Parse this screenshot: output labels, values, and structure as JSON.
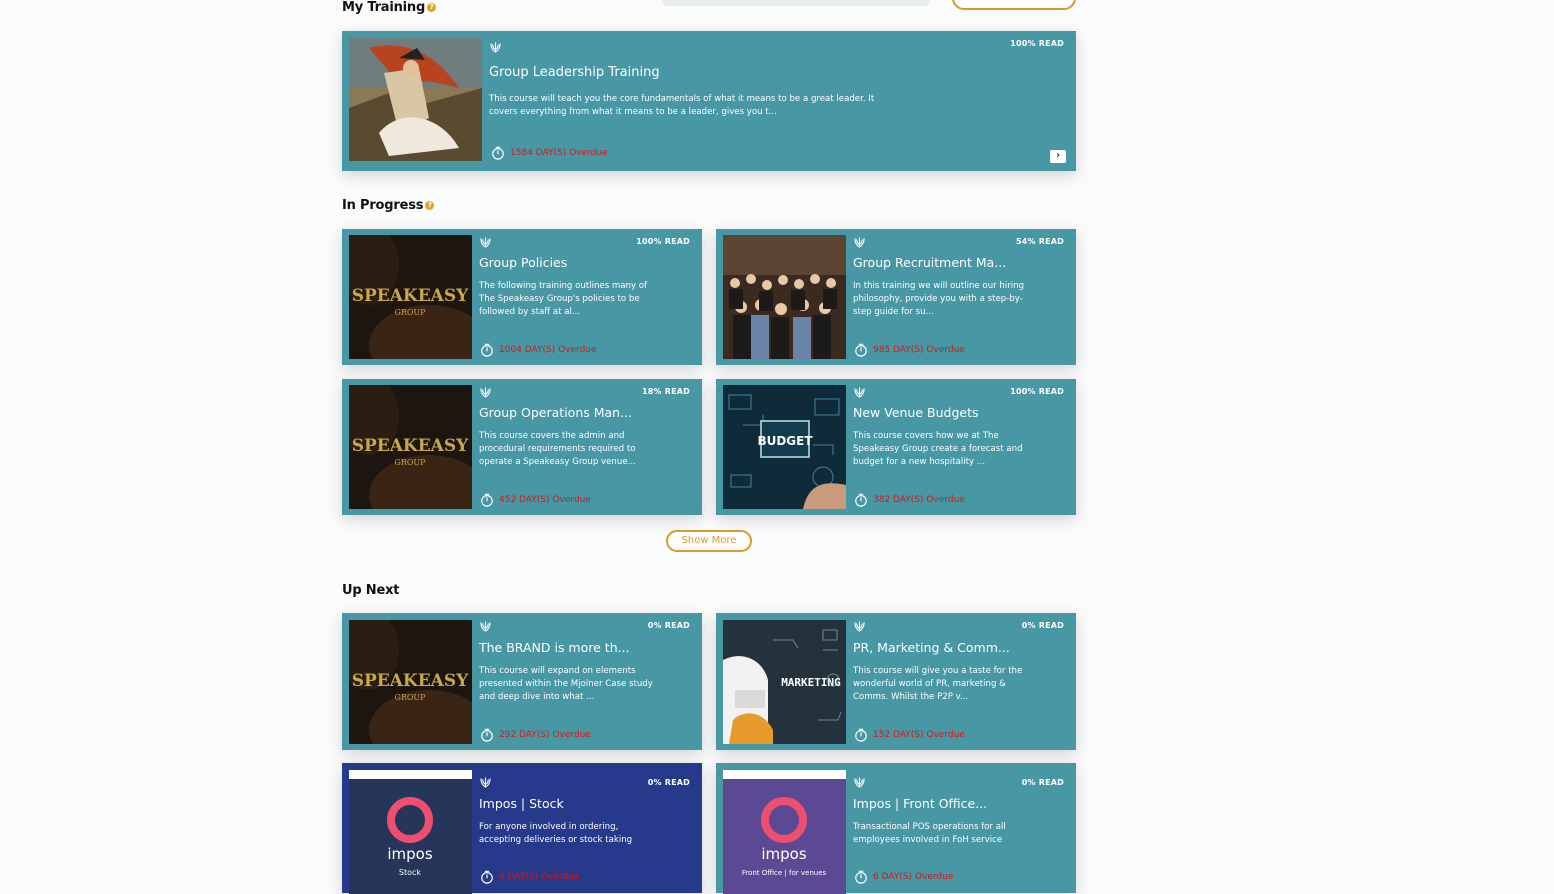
{
  "sections": {
    "my_training": "My Training",
    "in_progress": "In Progress",
    "up_next": "Up Next",
    "help_glyph": "?"
  },
  "featured": {
    "title": "Group Leadership Training",
    "progress": "100% READ",
    "description": "This course will teach you the core fundamentals of what it means to be a great leader. It covers everything from what it means to be a leader, gives you t...",
    "overdue": "1584 DAY(S) Overdue",
    "open_glyph": "›"
  },
  "in_progress": [
    {
      "title": "Group Policies",
      "progress": "100% READ",
      "description": "The following training outlines many of The Speakeasy Group's policies to be followed by staff at al...",
      "overdue": "1004 DAY(S) Overdue",
      "image": "speakeasy-logo"
    },
    {
      "title": "Group Recruitment Ma...",
      "progress": "54% READ",
      "description": "In this training we will outline our hiring philosophy, provide you with a step-by-step guide for su...",
      "overdue": "985 DAY(S) Overdue",
      "image": "team-photo"
    },
    {
      "title": "Group Operations Man...",
      "progress": "18% READ",
      "description": "This course covers the admin and procedural requirements required to operate a Speakeasy Group venue...",
      "overdue": "452 DAY(S) Overdue",
      "image": "speakeasy-logo"
    },
    {
      "title": "New Venue Budgets",
      "progress": "100% READ",
      "description": "This course covers how we at The Speakeasy Group create a forecast and budget for a new hospitality ...",
      "overdue": "382 DAY(S) Overdue",
      "image": "budget-graphic"
    }
  ],
  "show_more_label": "Show More",
  "up_next": [
    {
      "title": "The BRAND is more th...",
      "progress": "0% READ",
      "description": "This course will expand on elements presented within the Mjolner Case study and deep dive into what ...",
      "overdue": "292 DAY(S) Overdue",
      "image": "speakeasy-logo"
    },
    {
      "title": "PR, Marketing & Comm...",
      "progress": "0% READ",
      "description": "This course will give you a taste for the wonderful world of PR, marketing & Comms. Whilst the P2P v...",
      "overdue": "152 DAY(S) Overdue",
      "image": "marketing-graphic"
    },
    {
      "title": "Impos | Stock",
      "progress": "0% READ",
      "description": "For anyone involved in ordering, accepting deliveries or stock taking",
      "overdue": "6 DAY(S) Overdue",
      "image": "impos-stock"
    },
    {
      "title": "Impos | Front Office...",
      "progress": "0% READ",
      "description": "Transactional POS operations for all employees involved in FoH service",
      "overdue": "6 DAY(S) Overdue",
      "image": "impos-front-office"
    }
  ],
  "image_text": {
    "speakeasy": "SPEAKEASY",
    "group": "GROUP",
    "budget": "BUDGET",
    "marketing": "MARKETING",
    "impos": "impos",
    "stock": "Stock",
    "front_office": "Front Office | for venues"
  },
  "colors": {
    "card": "#4897a5",
    "card_navy": "#27398a",
    "accent": "#d69a2d",
    "overdue": "#d41818"
  }
}
